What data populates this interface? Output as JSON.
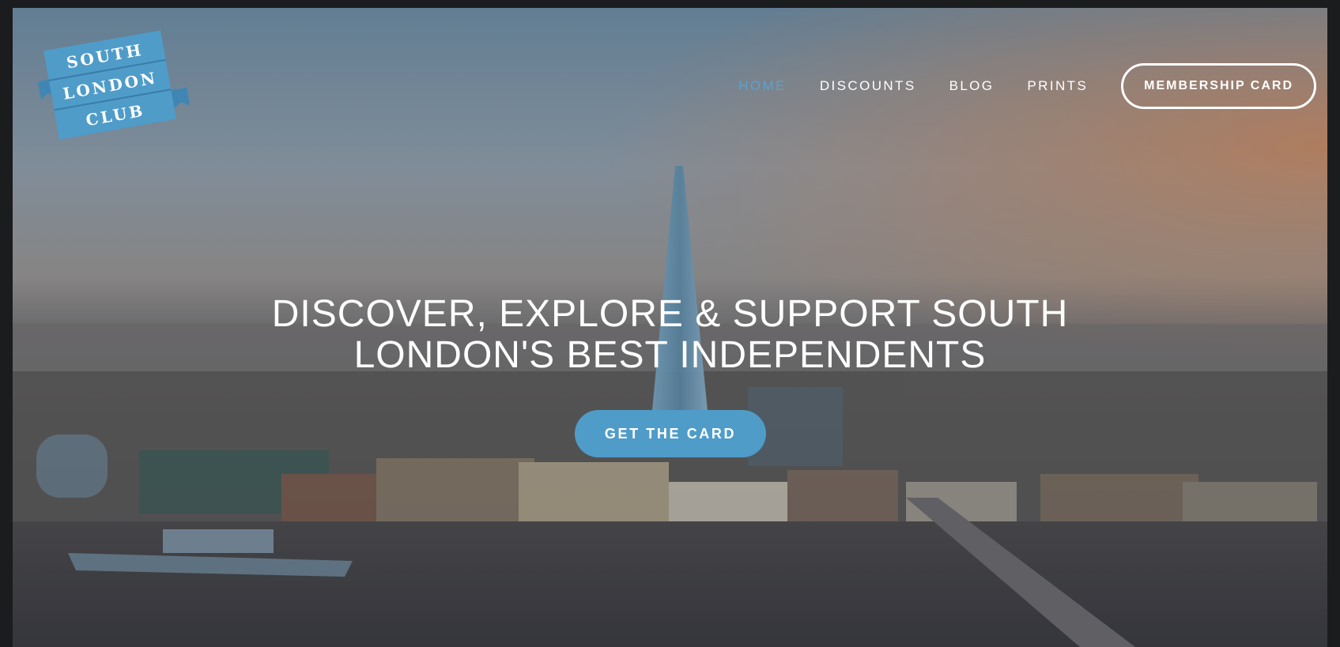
{
  "site": {
    "logo": {
      "line1": "SOUTH",
      "line2": "LONDON",
      "line3": "CLUB",
      "color": "#4f9cc9"
    }
  },
  "nav": {
    "items": [
      {
        "label": "HOME",
        "active": true
      },
      {
        "label": "DISCOUNTS",
        "active": false
      },
      {
        "label": "BLOG",
        "active": false
      },
      {
        "label": "PRINTS",
        "active": false
      }
    ],
    "membership_button": "MEMBERSHIP CARD"
  },
  "hero": {
    "line1": "DISCOVER, EXPLORE & SUPPORT SOUTH",
    "line2": "LONDON'S BEST INDEPENDENTS",
    "cta": "GET THE CARD"
  },
  "colors": {
    "accent": "#4f9cc9",
    "nav_active": "#5aa3cf",
    "text": "#ffffff"
  }
}
